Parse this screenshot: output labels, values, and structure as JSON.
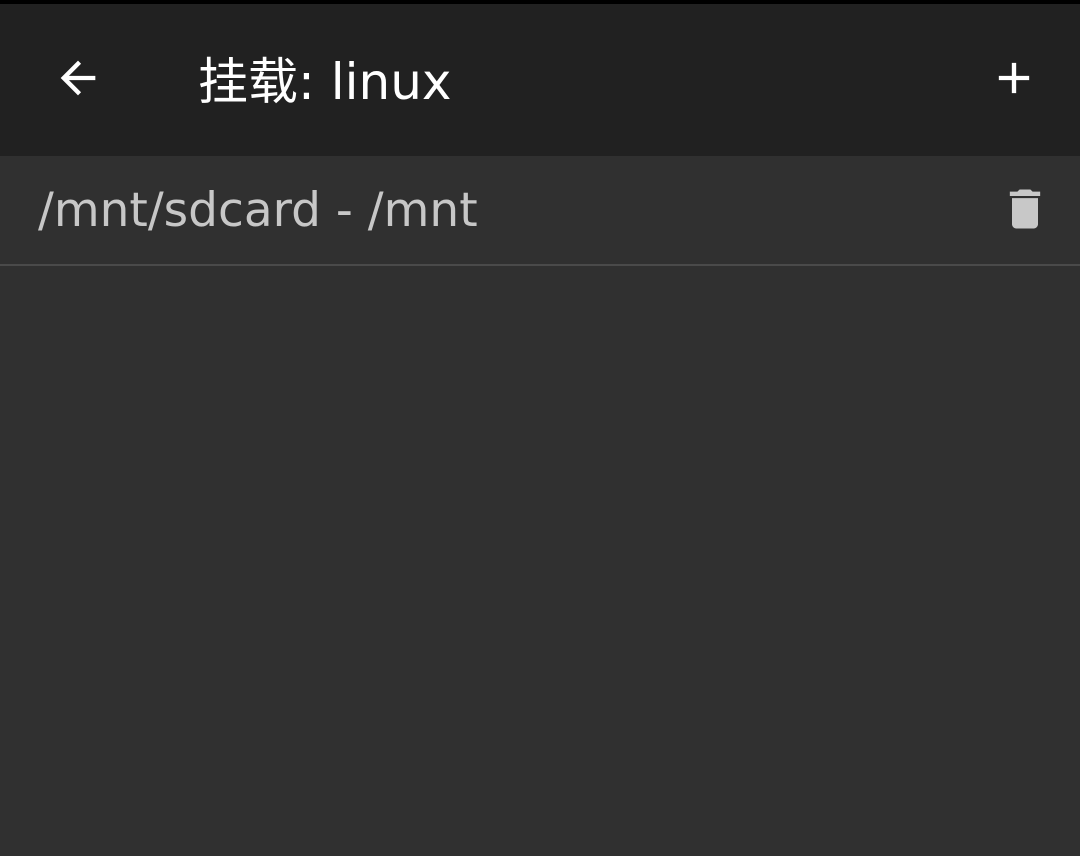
{
  "toolbar": {
    "title": "挂载: linux",
    "back_icon": "arrow-back-icon",
    "add_icon": "plus-icon"
  },
  "mounts": [
    {
      "label": "/mnt/sdcard - /mnt",
      "delete_icon": "trash-icon"
    }
  ],
  "colors": {
    "toolbar_bg": "#212121",
    "body_bg": "#303030",
    "item_text": "#c7c7c7",
    "icon_color": "#ffffff",
    "trash_color": "#c8c8c8",
    "divider": "#4a4a4a"
  }
}
